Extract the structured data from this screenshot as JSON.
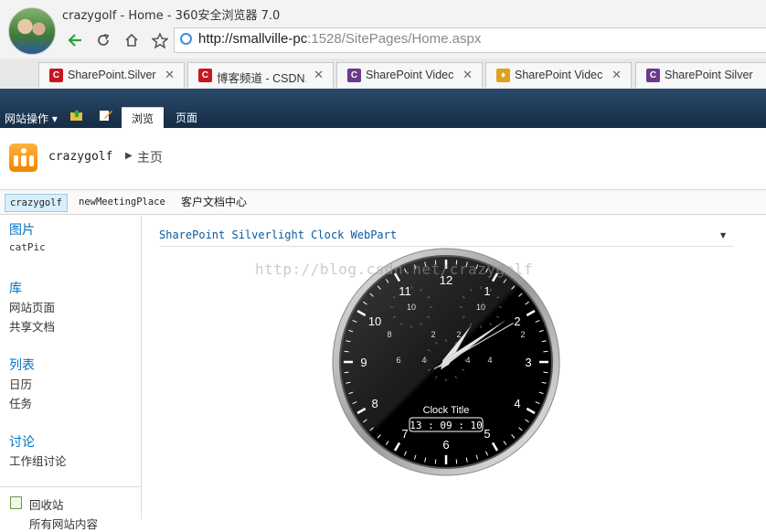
{
  "browser": {
    "window_title": "crazygolf - Home - 360安全浏览器 7.0",
    "url_host": "http://smallville-pc",
    "url_rest": ":1528/SitePages/Home.aspx",
    "tabs": [
      {
        "label": "SharePoint.Silver",
        "icon_color": "#c8161e",
        "icon_text": "C"
      },
      {
        "label": "博客频道 - CSDN.",
        "icon_color": "#c8161e",
        "icon_text": "C"
      },
      {
        "label": "SharePoint Videc",
        "icon_color": "#6a3a8a",
        "icon_text": "C"
      },
      {
        "label": "SharePoint Videc",
        "icon_color": "#e0a020",
        "icon_text": "♦"
      },
      {
        "label": "SharePoint Silver",
        "icon_color": "#6a3a8a",
        "icon_text": "C"
      }
    ]
  },
  "ribbon": {
    "site_actions": "网站操作",
    "tab_browse": "浏览",
    "tab_page": "页面"
  },
  "header": {
    "site_name": "crazygolf",
    "current_page": "主页"
  },
  "topnav": [
    "crazygolf",
    "newMeetingPlace",
    "客户文档中心"
  ],
  "leftnav": {
    "sections": [
      {
        "heading": "图片",
        "items": [
          "catPic"
        ]
      },
      {
        "heading": "库",
        "items": [
          "网站页面",
          "共享文档"
        ]
      },
      {
        "heading": "列表",
        "items": [
          "日历",
          "任务"
        ]
      },
      {
        "heading": "讨论",
        "items": [
          "工作组讨论"
        ]
      }
    ],
    "recycle_bin": "回收站",
    "all_content": "所有网站内容"
  },
  "webpart": {
    "title": "SharePoint Silverlight Clock WebPart",
    "watermark": "http://blog.csdn.net/crazygolf"
  },
  "clock": {
    "title": "Clock Title",
    "time": "13 : 09 : 10",
    "hour": 13,
    "minute": 9,
    "second": 10,
    "outer_numbers": [
      "12",
      "1",
      "2",
      "3",
      "4",
      "5",
      "6",
      "7",
      "8",
      "9",
      "10",
      "11"
    ],
    "inner_numbers": [
      "10",
      "2",
      "4",
      "6",
      "8",
      "10",
      "12"
    ],
    "colors": {
      "face": "#000000",
      "ring": "#c8c8c8",
      "text": "#ffffff"
    }
  }
}
